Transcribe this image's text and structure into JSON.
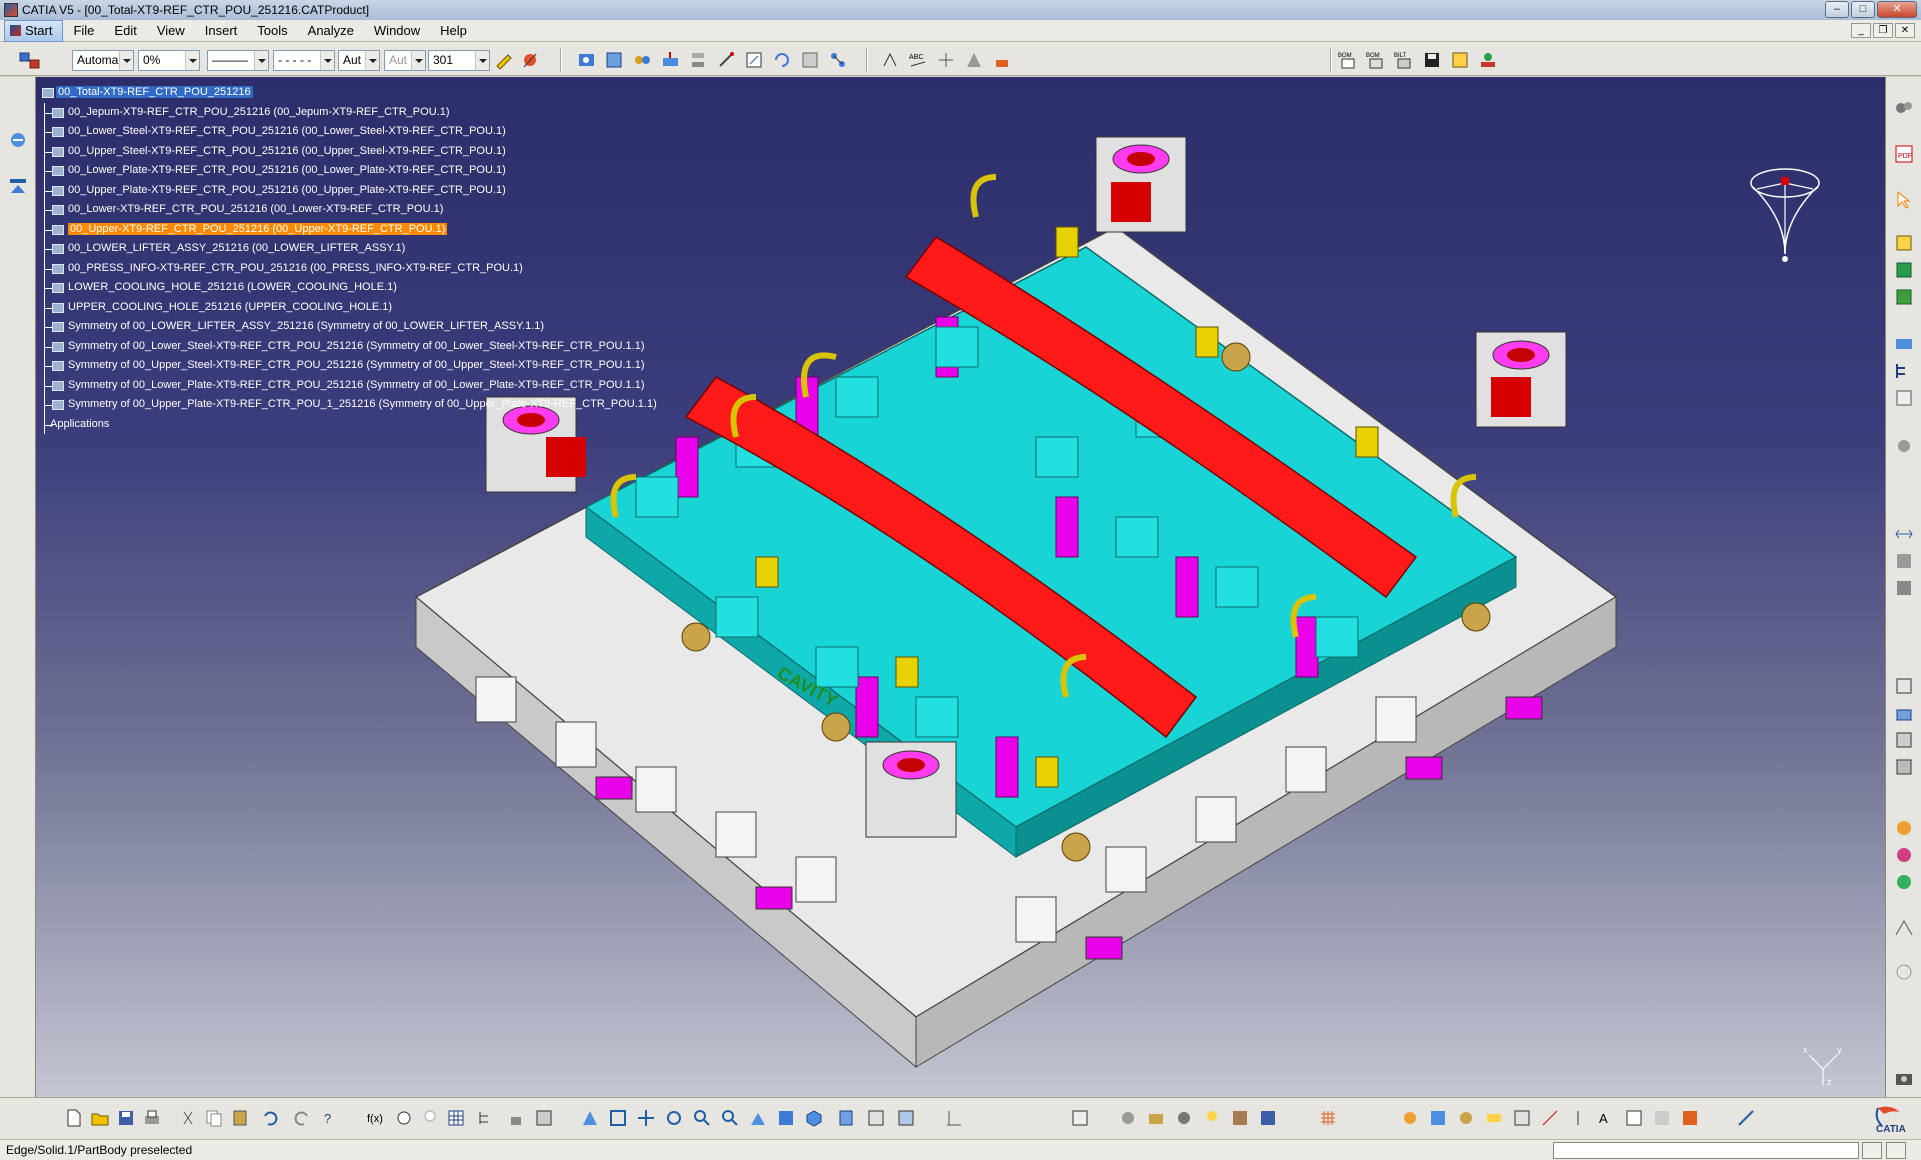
{
  "window": {
    "title": "CATIA V5 - [00_Total-XT9-REF_CTR_POU_251216.CATProduct]",
    "controls": {
      "minimize": "–",
      "maximize": "□",
      "close": "✕"
    }
  },
  "menu": {
    "items": [
      "Start",
      "File",
      "Edit",
      "View",
      "Insert",
      "Tools",
      "Analyze",
      "Window",
      "Help"
    ]
  },
  "toolbar": {
    "layer_combo": "Automa",
    "transparency_combo": "0%",
    "line_type_combo": "———",
    "line_weight_combo": "- - - - -",
    "auto_combo_1": "Aut",
    "auto_combo_2": "Aut",
    "number_combo": "301"
  },
  "spec_tree": {
    "root": "00_Total-XT9-REF_CTR_POU_251216",
    "items": [
      "00_Jepum-XT9-REF_CTR_POU_251216 (00_Jepum-XT9-REF_CTR_POU.1)",
      "00_Lower_Steel-XT9-REF_CTR_POU_251216 (00_Lower_Steel-XT9-REF_CTR_POU.1)",
      "00_Upper_Steel-XT9-REF_CTR_POU_251216 (00_Upper_Steel-XT9-REF_CTR_POU.1)",
      "00_Lower_Plate-XT9-REF_CTR_POU_251216 (00_Lower_Plate-XT9-REF_CTR_POU.1)",
      "00_Upper_Plate-XT9-REF_CTR_POU_251216 (00_Upper_Plate-XT9-REF_CTR_POU.1)",
      "00_Lower-XT9-REF_CTR_POU_251216 (00_Lower-XT9-REF_CTR_POU.1)",
      "00_Upper-XT9-REF_CTR_POU_251216 (00_Upper-XT9-REF_CTR_POU.1)",
      "00_LOWER_LIFTER_ASSY_251216 (00_LOWER_LIFTER_ASSY.1)",
      "00_PRESS_INFO-XT9-REF_CTR_POU_251216 (00_PRESS_INFO-XT9-REF_CTR_POU.1)",
      "LOWER_COOLING_HOLE_251216 (LOWER_COOLING_HOLE.1)",
      "UPPER_COOLING_HOLE_251216 (UPPER_COOLING_HOLE.1)",
      "Symmetry of 00_LOWER_LIFTER_ASSY_251216 (Symmetry of 00_LOWER_LIFTER_ASSY.1.1)",
      "Symmetry of 00_Lower_Steel-XT9-REF_CTR_POU_251216 (Symmetry of 00_Lower_Steel-XT9-REF_CTR_POU.1.1)",
      "Symmetry of 00_Upper_Steel-XT9-REF_CTR_POU_251216 (Symmetry of 00_Upper_Steel-XT9-REF_CTR_POU.1.1)",
      "Symmetry of 00_Lower_Plate-XT9-REF_CTR_POU_251216 (Symmetry of 00_Lower_Plate-XT9-REF_CTR_POU.1.1)",
      "Symmetry of 00_Upper_Plate-XT9-REF_CTR_POU_1_251216 (Symmetry of 00_Upper_Plate-XT9-REF_CTR_POU.1.1)"
    ],
    "applications": "Applications"
  },
  "viewport": {
    "model_label": "CAVITY",
    "colors": {
      "base": "#e9e9e9",
      "plate": "#19d4d4",
      "part": "#ff1a1a",
      "accent": "#e800e8",
      "clamp": "#d8c400"
    },
    "axis_labels": {
      "x": "x",
      "y": "y",
      "z": "z"
    }
  },
  "status": {
    "message": "Edge/Solid.1/PartBody preselected"
  },
  "branding": {
    "logo_text": "CATIA"
  }
}
